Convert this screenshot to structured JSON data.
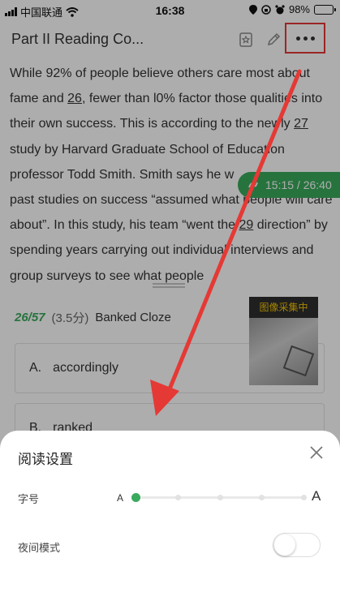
{
  "status_bar": {
    "carrier": "中国联通",
    "time": "16:38",
    "battery": "98%",
    "battery_level": 0.98
  },
  "header": {
    "title": "Part II Reading Co..."
  },
  "passage": {
    "s1": "While 92% of people believe others care most about fame and ",
    "b26": "26",
    "s2": ", fewer than l0% factor those qualities into their own success. This is according to the newly ",
    "b27": "27",
    "s3": " study by Harvard Graduate School of Education professor Todd Smith. Smith says he w",
    "s4": " past studies on success “assumed what people will care about”. In this study, his team “went the ",
    "b29": "29",
    "s5": " direction” by spending years carrying out individual interviews and group surveys to see what people"
  },
  "timer": {
    "text": "15:15 / 26:40"
  },
  "question": {
    "index": "26/57",
    "score": "(3.5分)",
    "type": "Banked Cloze",
    "options": [
      {
        "letter": "A.",
        "text": "accordingly"
      },
      {
        "letter": "B.",
        "text": "ranked"
      }
    ]
  },
  "camera": {
    "label": "图像采集中"
  },
  "settings_sheet": {
    "title": "阅读设置",
    "font_size_label": "字号",
    "font_small": "A",
    "font_large": "A",
    "font_level": 0,
    "font_level_count": 5,
    "night_mode_label": "夜间模式",
    "night_mode_on": false
  },
  "colors": {
    "accent": "#3aaa5c",
    "annotation": "#e53935"
  }
}
